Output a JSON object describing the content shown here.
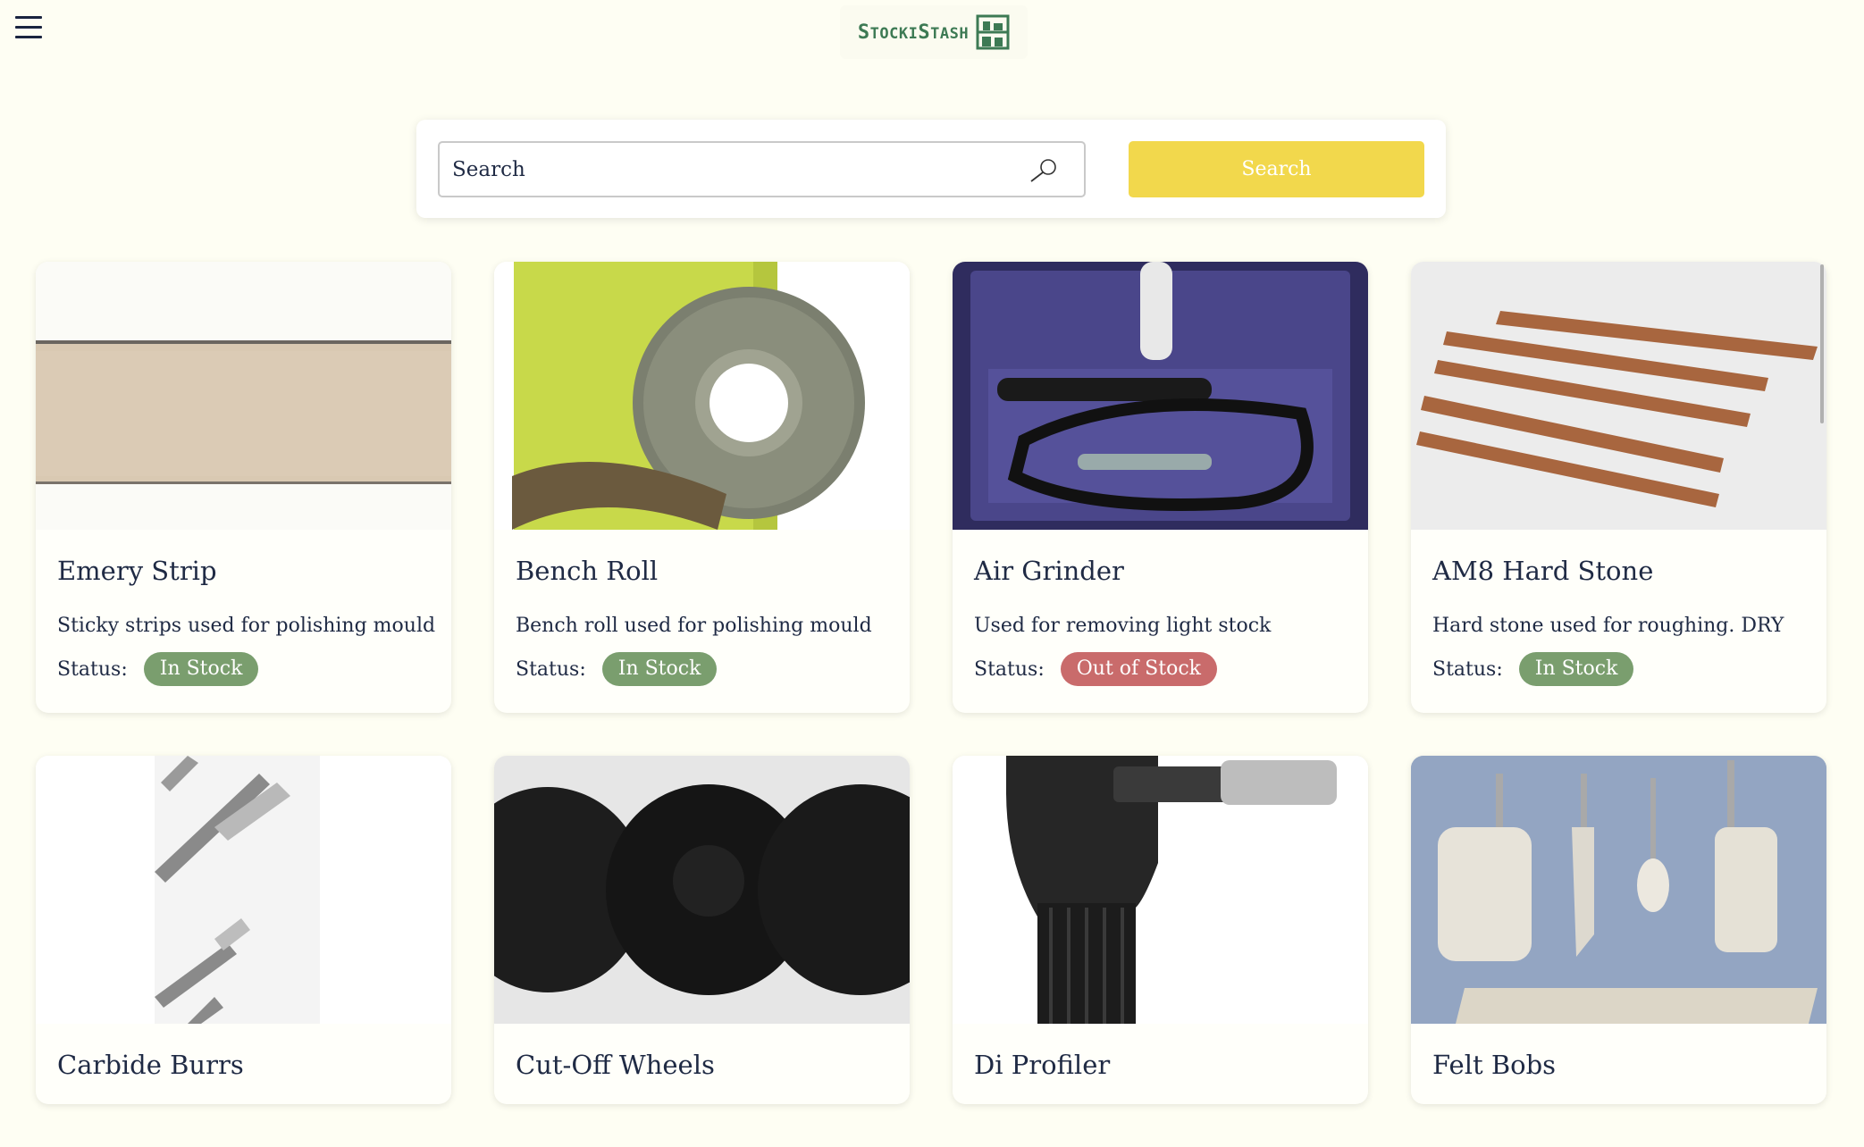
{
  "header": {
    "logo_text_s1": "S",
    "logo_text_1": "TOCKI",
    "logo_text_s2": "S",
    "logo_text_2": "TASH"
  },
  "search": {
    "placeholder": "Search",
    "button_label": "Search"
  },
  "status_label": "Status:",
  "products": [
    {
      "title": "Emery Strip",
      "description": "Sticky strips used for polishing mould",
      "status": "In Stock"
    },
    {
      "title": "Bench Roll",
      "description": "Bench roll used for polishing mould",
      "status": "In Stock"
    },
    {
      "title": "Air Grinder",
      "description": "Used for removing light stock",
      "status": "Out of Stock"
    },
    {
      "title": "AM8 Hard Stone",
      "description": "Hard stone used for roughing. DRY",
      "status": "In Stock"
    },
    {
      "title": "Carbide Burrs"
    },
    {
      "title": "Cut-Off Wheels"
    },
    {
      "title": "Di Profiler"
    },
    {
      "title": "Felt Bobs"
    }
  ],
  "colors": {
    "background": "#fefef3",
    "accent_button": "#f2d84c",
    "in_stock": "#7a9e6e",
    "out_of_stock": "#c96b6b",
    "logo": "#3d7a54"
  }
}
